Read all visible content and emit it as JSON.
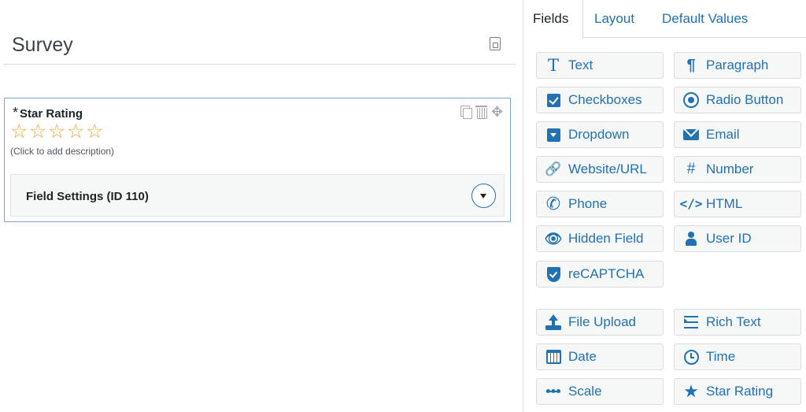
{
  "form": {
    "title": "Survey"
  },
  "field_card": {
    "required_mark": "*",
    "label": "Star Rating",
    "stars": [
      "☆",
      "☆",
      "☆",
      "☆",
      "☆"
    ],
    "description": "(Click to add description)",
    "settings_title": "Field Settings (ID 110)"
  },
  "tabs": {
    "fields": "Fields",
    "layout": "Layout",
    "defaults": "Default Values"
  },
  "field_buttons": {
    "text": "Text",
    "paragraph": "Paragraph",
    "checkboxes": "Checkboxes",
    "radio": "Radio Button",
    "dropdown": "Dropdown",
    "email": "Email",
    "url": "Website/URL",
    "number": "Number",
    "phone": "Phone",
    "html": "HTML",
    "hidden": "Hidden Field",
    "user_id": "User ID",
    "recaptcha": "reCAPTCHA",
    "file_upload": "File Upload",
    "rich_text": "Rich Text",
    "date": "Date",
    "time": "Time",
    "scale": "Scale",
    "star_rating": "Star Rating"
  },
  "glyphs": {
    "text": "T",
    "paragraph": "¶",
    "link": "🔗",
    "hash": "#",
    "phone": "✆",
    "code": "</>",
    "eye": "👁",
    "star": "★",
    "move": "✥"
  },
  "colors": {
    "accent": "#2271b1",
    "star": "#e5a43a",
    "card_border": "#7ea7d2"
  }
}
